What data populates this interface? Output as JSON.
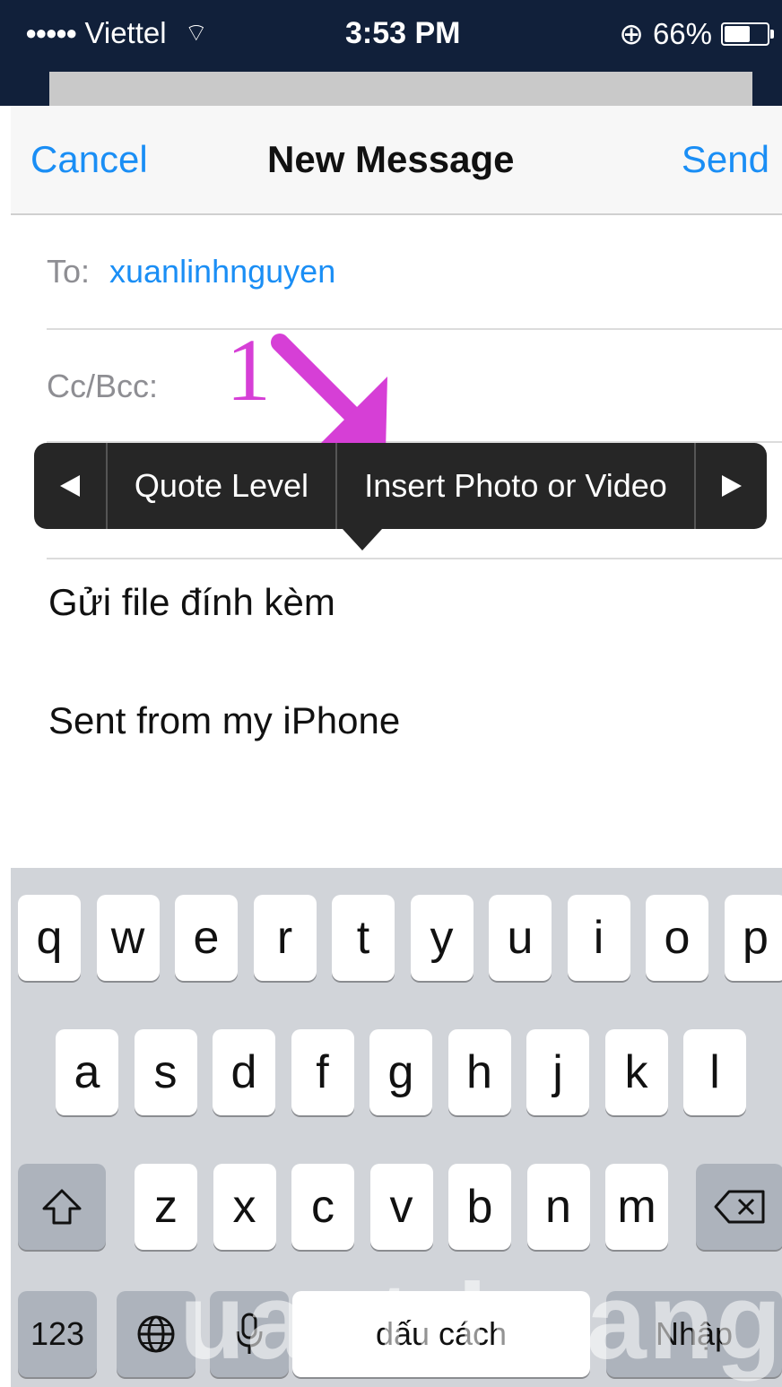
{
  "status_bar": {
    "carrier": "Viettel",
    "time": "3:53 PM",
    "battery": "66%",
    "battery_level": 0.66
  },
  "nav": {
    "cancel": "Cancel",
    "title": "New Message",
    "send": "Send"
  },
  "fields": {
    "to_label": "To:",
    "to_value": "xuanlinhnguyen",
    "cc_label": "Cc/Bcc:"
  },
  "annotation": {
    "number": "1",
    "color": "#d63fd6"
  },
  "callout": {
    "quote": "Quote Level",
    "insert": "Insert Photo or Video"
  },
  "body": {
    "line1": "Gửi file đính kèm",
    "line2": "Sent from my iPhone"
  },
  "keyboard": {
    "row1": [
      "q",
      "w",
      "e",
      "r",
      "t",
      "y",
      "u",
      "i",
      "o",
      "p"
    ],
    "row2": [
      "a",
      "s",
      "d",
      "f",
      "g",
      "h",
      "j",
      "k",
      "l"
    ],
    "row3": [
      "z",
      "x",
      "c",
      "v",
      "b",
      "n",
      "m"
    ],
    "numbers": "123",
    "space": "dấu cách",
    "return": "Nhập"
  },
  "watermark": "uantrimang",
  "colors": {
    "accent": "#1a8ef5",
    "status_bar": "#11203a",
    "keyboard_bg": "#d1d4d9"
  }
}
